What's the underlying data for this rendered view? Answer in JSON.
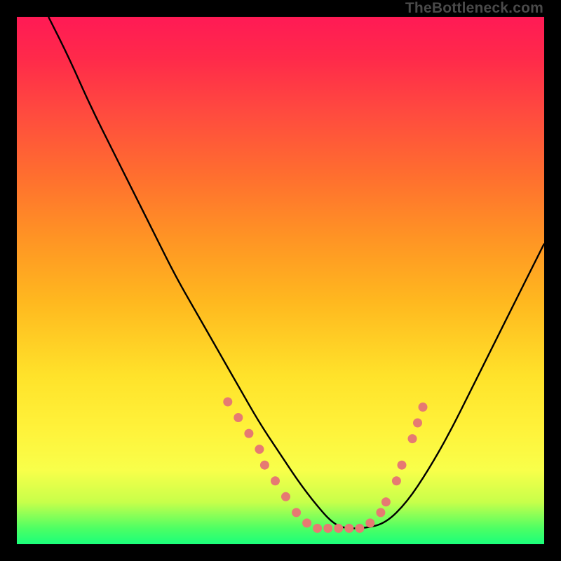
{
  "watermark": "TheBottleneck.com",
  "colors": {
    "frame": "#000000",
    "gradient_top": "#ff1a55",
    "gradient_mid1": "#ff9424",
    "gradient_mid2": "#ffe22a",
    "gradient_bottom": "#1aff7a",
    "curve": "#000000",
    "dots": "#e67a72"
  },
  "chart_data": {
    "type": "line",
    "title": "",
    "xlabel": "",
    "ylabel": "",
    "xlim": [
      0,
      100
    ],
    "ylim": [
      0,
      100
    ],
    "series": [
      {
        "name": "bottleneck-curve",
        "x": [
          6,
          10,
          14,
          18,
          22,
          26,
          30,
          34,
          38,
          42,
          46,
          50,
          54,
          58,
          60,
          62,
          66,
          70,
          74,
          78,
          82,
          86,
          90,
          94,
          98,
          100
        ],
        "values": [
          100,
          92,
          83,
          75,
          67,
          59,
          51,
          44,
          37,
          30,
          23,
          17,
          11,
          6,
          4,
          3,
          3,
          4,
          8,
          14,
          21,
          29,
          37,
          45,
          53,
          57
        ]
      }
    ],
    "highlight_dots": [
      {
        "x": 40,
        "y": 27
      },
      {
        "x": 42,
        "y": 24
      },
      {
        "x": 44,
        "y": 21
      },
      {
        "x": 46,
        "y": 18
      },
      {
        "x": 47,
        "y": 15
      },
      {
        "x": 49,
        "y": 12
      },
      {
        "x": 51,
        "y": 9
      },
      {
        "x": 53,
        "y": 6
      },
      {
        "x": 55,
        "y": 4
      },
      {
        "x": 57,
        "y": 3
      },
      {
        "x": 59,
        "y": 3
      },
      {
        "x": 61,
        "y": 3
      },
      {
        "x": 63,
        "y": 3
      },
      {
        "x": 65,
        "y": 3
      },
      {
        "x": 67,
        "y": 4
      },
      {
        "x": 69,
        "y": 6
      },
      {
        "x": 70,
        "y": 8
      },
      {
        "x": 72,
        "y": 12
      },
      {
        "x": 73,
        "y": 15
      },
      {
        "x": 75,
        "y": 20
      },
      {
        "x": 76,
        "y": 23
      },
      {
        "x": 77,
        "y": 26
      }
    ]
  }
}
